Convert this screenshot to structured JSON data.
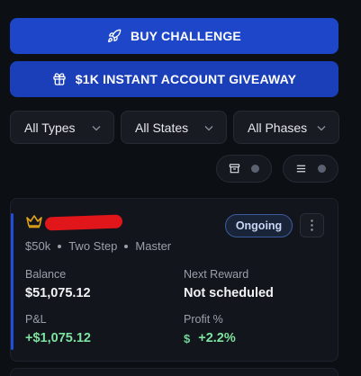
{
  "actions": {
    "buy_challenge": "BUY CHALLENGE",
    "giveaway": "$1K INSTANT ACCOUNT GIVEAWAY"
  },
  "filters": {
    "types": "All Types",
    "states": "All States",
    "phases": "All Phases"
  },
  "view_toggles": [
    {
      "icon": "archive-icon"
    },
    {
      "icon": "list-icon"
    }
  ],
  "account_card": {
    "status": "Ongoing",
    "meta": [
      "$50k",
      "Two Step",
      "Master"
    ],
    "balance_label": "Balance",
    "balance_value": "$51,075.12",
    "next_reward_label": "Next Reward",
    "next_reward_value": "Not scheduled",
    "pnl_label": "P&L",
    "pnl_value": "+$1,075.12",
    "profit_label": "Profit %",
    "profit_value": "+2.2%",
    "profit_currency_symbol": "$"
  },
  "colors": {
    "primary": "#1d47c8",
    "background": "#0c0f14",
    "card": "#12151b",
    "positive": "#7ee2a0",
    "crown": "#e0a21a"
  }
}
